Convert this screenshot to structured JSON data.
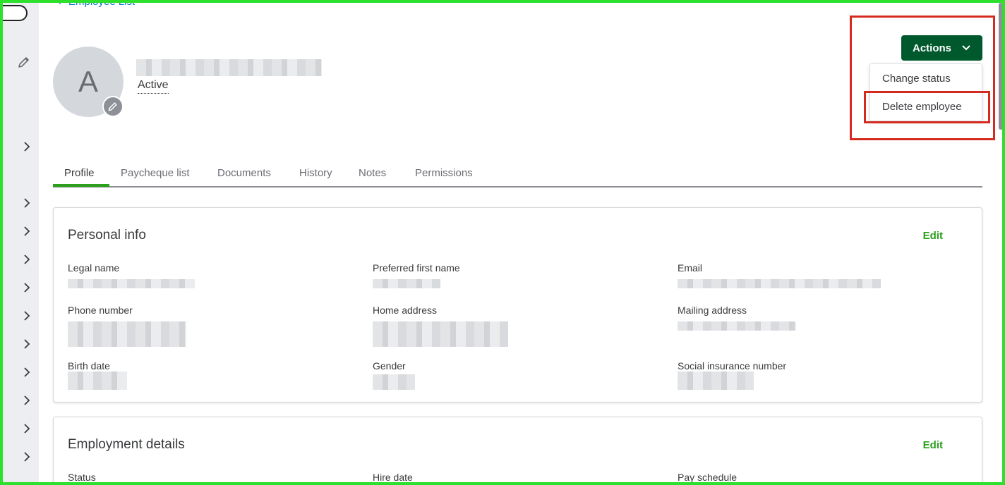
{
  "back_link": {
    "label": "Employee List"
  },
  "employee": {
    "avatar_initial": "A",
    "status": "Active"
  },
  "actions": {
    "label": "Actions",
    "menu": [
      {
        "label": "Change status"
      },
      {
        "label": "Delete employee"
      }
    ]
  },
  "tabs": [
    {
      "label": "Profile"
    },
    {
      "label": "Paycheque list"
    },
    {
      "label": "Documents"
    },
    {
      "label": "History"
    },
    {
      "label": "Notes"
    },
    {
      "label": "Permissions"
    }
  ],
  "personal_info": {
    "title": "Personal info",
    "edit_label": "Edit",
    "fields": [
      {
        "label": "Legal name"
      },
      {
        "label": "Preferred first name"
      },
      {
        "label": "Email"
      },
      {
        "label": "Phone number"
      },
      {
        "label": "Home address"
      },
      {
        "label": "Mailing address"
      },
      {
        "label": "Birth date"
      },
      {
        "label": "Gender"
      },
      {
        "label": "Social insurance number"
      }
    ]
  },
  "employment_details": {
    "title": "Employment details",
    "edit_label": "Edit",
    "fields": [
      {
        "label": "Status"
      },
      {
        "label": "Hire date"
      },
      {
        "label": "Pay schedule"
      }
    ]
  },
  "colors": {
    "brand_green": "#2ca01c",
    "actions_bg": "#00592d",
    "link_blue": "#0077c5",
    "highlight_red": "#d52b1e",
    "frame_green": "#2ce02c"
  }
}
